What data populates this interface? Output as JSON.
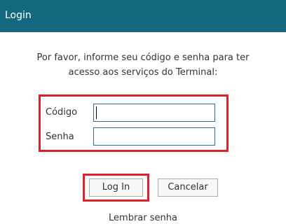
{
  "dialog": {
    "title": "Login",
    "message_line1": "Por favor, informe seu código e senha para ter",
    "message_line2": "acesso aos serviços do Terminal:"
  },
  "form": {
    "codigo_label": "Código",
    "codigo_value": "",
    "senha_label": "Senha",
    "senha_value": ""
  },
  "buttons": {
    "login_label": "Log In",
    "cancel_label": "Cancelar"
  },
  "links": {
    "remember_password": "Lembrar senha"
  },
  "colors": {
    "titlebar_bg": "#13677f",
    "highlight": "#e0202a",
    "input_border": "#2e6da4"
  }
}
